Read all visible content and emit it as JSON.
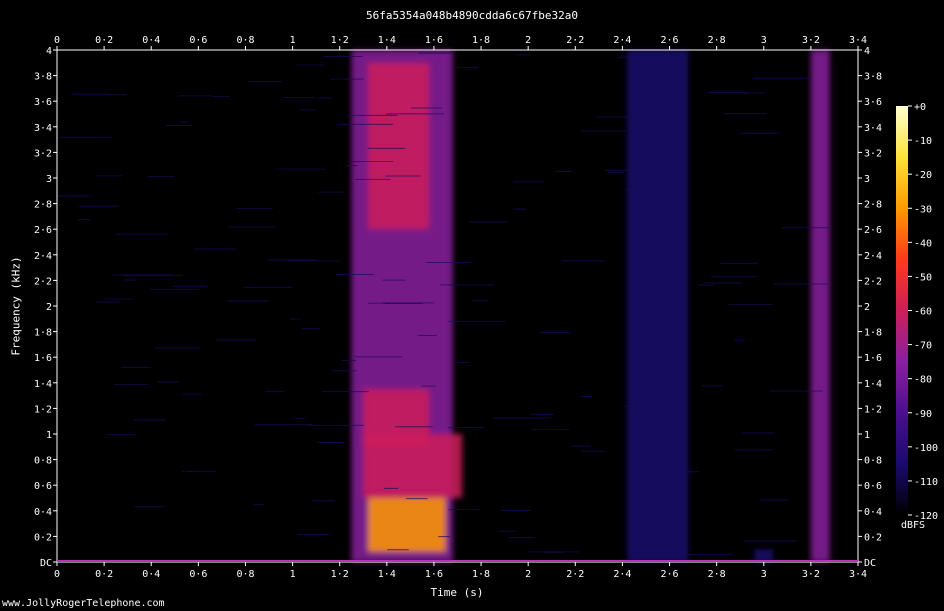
{
  "title": "56fa5354a048b4890cdda6c67fbe32a0",
  "watermark": "www.JollyRogerTelephone.com",
  "chart_data": {
    "type": "heatmap",
    "title": "56fa5354a048b4890cdda6c67fbe32a0",
    "xlabel": "Time (s)",
    "ylabel": "Frequency (kHz)",
    "xlim": [
      0,
      3.4
    ],
    "ylim": [
      0,
      4
    ],
    "x_ticks": [
      "0",
      "0·2",
      "0·4",
      "0·6",
      "0·8",
      "1",
      "1·2",
      "1·4",
      "1·6",
      "1·8",
      "2",
      "2·2",
      "2·4",
      "2·6",
      "2·8",
      "3",
      "3·2",
      "3·4"
    ],
    "x_tick_values": [
      0,
      0.2,
      0.4,
      0.6,
      0.8,
      1,
      1.2,
      1.4,
      1.6,
      1.8,
      2,
      2.2,
      2.4,
      2.6,
      2.8,
      3,
      3.2,
      3.4
    ],
    "y_ticks": [
      "DC",
      "0·2",
      "0·4",
      "0·6",
      "0·8",
      "1",
      "1·2",
      "1·4",
      "1·6",
      "1·8",
      "2",
      "2·2",
      "2·4",
      "2·6",
      "2·8",
      "3",
      "3·2",
      "3·4",
      "3·6",
      "3·8",
      "4"
    ],
    "y_tick_values": [
      0,
      0.2,
      0.4,
      0.6,
      0.8,
      1,
      1.2,
      1.4,
      1.6,
      1.8,
      2,
      2.2,
      2.4,
      2.6,
      2.8,
      3,
      3.2,
      3.4,
      3.6,
      3.8,
      4
    ],
    "colorbar": {
      "unit": "dBFS",
      "ticks": [
        "+0",
        "-10",
        "-20",
        "-30",
        "-40",
        "-50",
        "-60",
        "-70",
        "-80",
        "-90",
        "-100",
        "-110",
        "-120"
      ],
      "tick_values": [
        0,
        -10,
        -20,
        -30,
        -40,
        -50,
        -60,
        -70,
        -80,
        -90,
        -100,
        -110,
        -120
      ],
      "range": [
        -120,
        0
      ],
      "colors": [
        "#000000",
        "#1a0a6e",
        "#4a0f8f",
        "#8a1fa0",
        "#cc1f5a",
        "#ff3a1a",
        "#ff9a00",
        "#ffe23a",
        "#ffffd0"
      ]
    },
    "regions": [
      {
        "t0": 1.25,
        "t1": 1.68,
        "f0": 0.0,
        "f1": 4.0,
        "level_db": -75
      },
      {
        "t0": 1.32,
        "t1": 1.58,
        "f0": 2.6,
        "f1": 3.9,
        "level_db": -58
      },
      {
        "t0": 1.3,
        "t1": 1.58,
        "f0": 0.9,
        "f1": 1.35,
        "level_db": -55
      },
      {
        "t0": 1.3,
        "t1": 1.72,
        "f0": 0.5,
        "f1": 1.0,
        "level_db": -60
      },
      {
        "t0": 1.32,
        "t1": 1.65,
        "f0": 0.08,
        "f1": 0.5,
        "level_db": -35
      },
      {
        "t0": 2.42,
        "t1": 2.68,
        "f0": 0.0,
        "f1": 4.0,
        "level_db": -105
      },
      {
        "t0": 3.2,
        "t1": 3.28,
        "f0": 0.0,
        "f1": 4.0,
        "level_db": -80
      },
      {
        "t0": 2.96,
        "t1": 3.04,
        "f0": 0.0,
        "f1": 0.1,
        "level_db": -100
      }
    ],
    "background_db": -118
  }
}
